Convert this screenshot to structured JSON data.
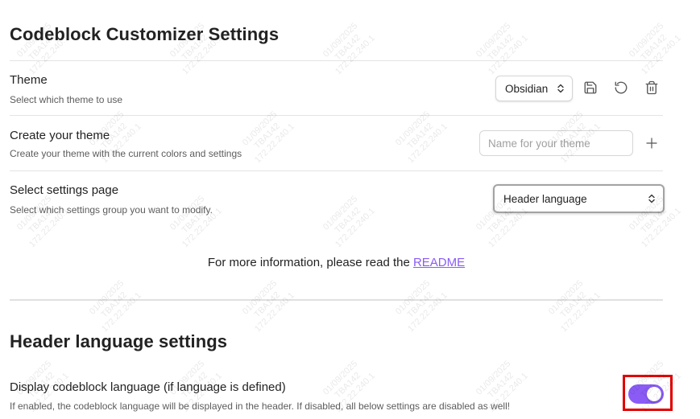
{
  "customizer": {
    "title": "Codeblock Customizer Settings"
  },
  "theme": {
    "name": "Theme",
    "description": "Select which theme to use",
    "selected": "Obsidian",
    "save_icon": "save-icon",
    "reset_icon": "reset-icon",
    "delete_icon": "trash-icon"
  },
  "create_theme": {
    "name": "Create your theme",
    "description": "Create your theme with the current colors and settings",
    "input_value": "",
    "placeholder": "Name for your theme",
    "add_icon": "plus-icon"
  },
  "settings_page": {
    "name": "Select settings page",
    "description": "Select which settings group you want to modify.",
    "selected": "Header language"
  },
  "info": {
    "prefix": "For more information, please read the ",
    "link_text": "README"
  },
  "header_language": {
    "title": "Header language settings",
    "display_name": "Display codeblock language (if language is defined)",
    "display_description": "If enabled, the codeblock language will be displayed in the header. If disabled, all below settings are disabled as well!",
    "display_enabled": true
  },
  "colors": {
    "accent": "#8a5cf5",
    "highlight_box": "#e00000"
  },
  "watermark": {
    "date": "01/09/2025",
    "user": "TBA142",
    "ip": "172.22.240.1"
  }
}
